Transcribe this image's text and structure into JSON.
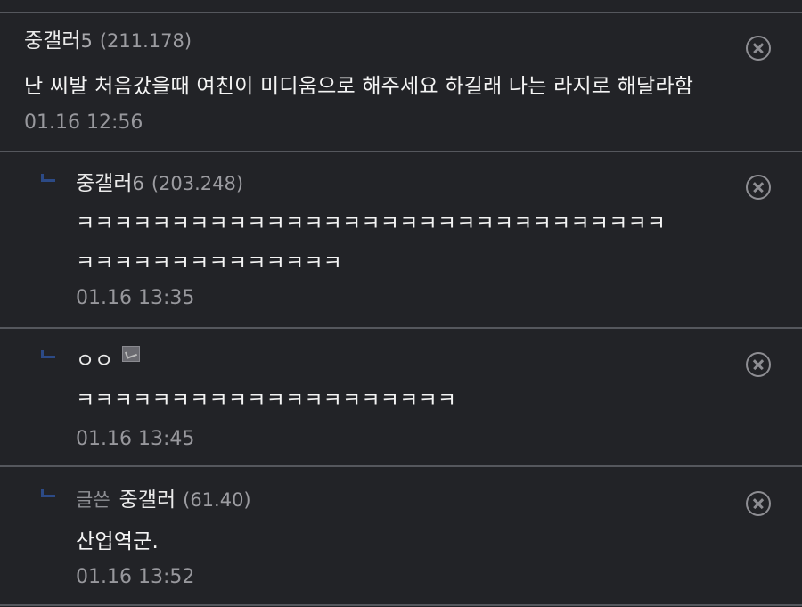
{
  "comments": [
    {
      "nick": "중갤러",
      "nick_num": "5",
      "ip": "(211.178)",
      "text": [
        "난 씨발 처음갔을때 여친이 미디움으로 해주세요 하길래 나는 라지로 해달라함"
      ],
      "time": "01.16 12:56",
      "delete_icon": "close-circle-icon"
    },
    {
      "nick": "중갤러",
      "nick_num": "6",
      "ip": "(203.248)",
      "text": [
        "ㅋㅋㅋㅋㅋㅋㅋㅋㅋㅋㅋㅋㅋㅋㅋㅋㅋㅋㅋㅋㅋㅋㅋㅋㅋㅋㅋㅋㅋㅋㅋ",
        "ㅋㅋㅋㅋㅋㅋㅋㅋㅋㅋㅋㅋㅋㅋ"
      ],
      "time": "01.16 13:35",
      "delete_icon": "close-circle-icon"
    },
    {
      "nick": "ㅇㅇ",
      "text": [
        "ㅋㅋㅋㅋㅋㅋㅋㅋㅋㅋㅋㅋㅋㅋㅋㅋㅋㅋㅋㅋ"
      ],
      "time": "01.16 13:45",
      "delete_icon": "close-circle-icon"
    },
    {
      "op_tag": "글쓴",
      "nick": "중갤러",
      "ip": "(61.40)",
      "text": [
        "산업역군."
      ],
      "time": "01.16 13:52",
      "delete_icon": "close-circle-icon"
    }
  ],
  "colors": {
    "background": "#222327",
    "separator": "#55575d",
    "reply_marker": "#2c4a86",
    "text": "#f4f4f4",
    "meta": "#98989d"
  }
}
